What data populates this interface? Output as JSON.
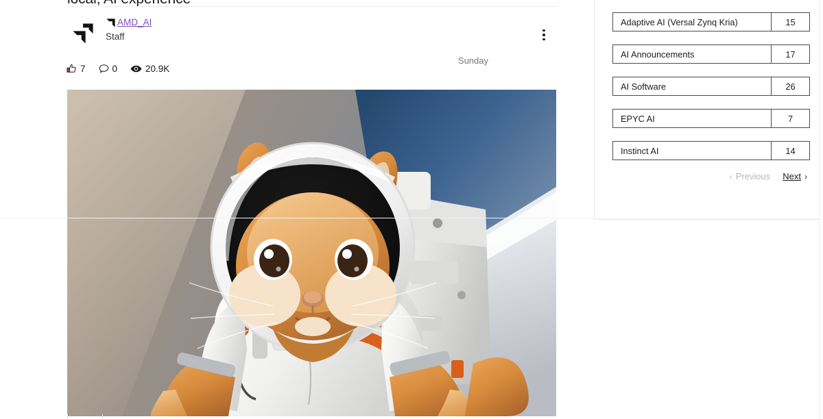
{
  "post": {
    "title": "local, AI experience",
    "author_name": "AMD_AI",
    "author_role": "Staff",
    "timestamp": "Sunday",
    "avatar_icon": "amd-logo-icon",
    "badge_icon": "amd-badge-icon",
    "menu_icon": "kebab-menu-icon",
    "stats": [
      {
        "icon": "thumbs-up-icon",
        "value": "7",
        "name": "likes"
      },
      {
        "icon": "comment-bubble-icon",
        "value": "0",
        "name": "comments"
      },
      {
        "icon": "eye-icon",
        "value": "20.9K",
        "name": "views"
      }
    ],
    "image_alt": "squirrel-astronaut-image"
  },
  "sidebar": {
    "categories": [
      {
        "label": "Adaptive AI (Versal Zynq Kria)",
        "count": "15"
      },
      {
        "label": "AI Announcements",
        "count": "17"
      },
      {
        "label": "AI Software",
        "count": "26"
      },
      {
        "label": "EPYC AI",
        "count": "7"
      },
      {
        "label": "Instinct AI",
        "count": "14"
      }
    ],
    "pagination": {
      "previous_label": "Previous",
      "previous_chevron": "‹",
      "next_label": "Next",
      "next_chevron": "›"
    }
  },
  "colors": {
    "link": "#7a4fc0",
    "text": "#1b1b1b",
    "muted": "#767676",
    "disabled": "#b6b6b6",
    "border": "#4a4a4a",
    "card_border": "#e7e7e7"
  }
}
